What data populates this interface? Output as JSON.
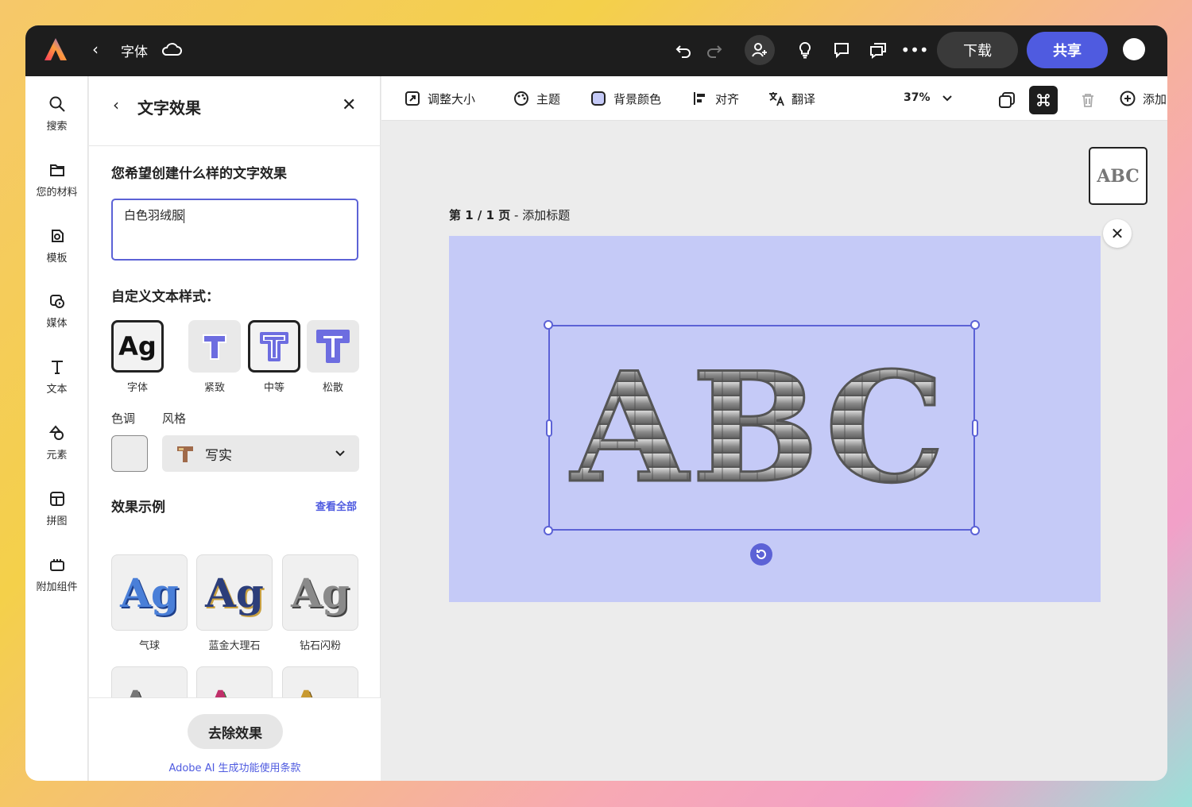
{
  "header": {
    "title": "字体",
    "download_label": "下载",
    "share_label": "共享"
  },
  "rail": {
    "items": [
      {
        "label": "搜索",
        "icon": "search-icon"
      },
      {
        "label": "您的材料",
        "icon": "folder-icon"
      },
      {
        "label": "模板",
        "icon": "templates-icon"
      },
      {
        "label": "媒体",
        "icon": "media-icon"
      },
      {
        "label": "文本",
        "icon": "text-icon"
      },
      {
        "label": "元素",
        "icon": "shapes-icon"
      },
      {
        "label": "拼图",
        "icon": "grid-icon"
      },
      {
        "label": "附加组件",
        "icon": "addons-icon"
      }
    ]
  },
  "panel": {
    "title": "文字效果",
    "question": "您希望创建什么样的文字效果",
    "prompt_value": "白色羽绒服",
    "custom_label": "自定义文本样式：",
    "styles": [
      {
        "label": "字体",
        "selected": true
      },
      {
        "label": "紧致",
        "selected": false
      },
      {
        "label": "中等",
        "selected": true
      },
      {
        "label": "松散",
        "selected": false
      }
    ],
    "tone_label": "色调",
    "style_label": "风格",
    "style_value": "写实",
    "examples_label": "效果示例",
    "see_all": "查看全部",
    "examples": [
      {
        "label": "气球",
        "text": "Ag",
        "color": "#4a7fd8"
      },
      {
        "label": "蓝金大理石",
        "text": "Ag",
        "color": "#2c3e7a"
      },
      {
        "label": "钻石闪粉",
        "text": "Ag",
        "color": "#8a8a8a"
      },
      {
        "label": "",
        "text": "Ag",
        "color": "#777777"
      },
      {
        "label": "",
        "text": "Ag",
        "color": "#c0306a"
      },
      {
        "label": "",
        "text": "Ag",
        "color": "#c89a30"
      }
    ],
    "remove_label": "去除效果",
    "terms": "Adobe AI 生成功能使用条款"
  },
  "toolbar": {
    "resize": "调整大小",
    "theme": "主题",
    "bg_color": "背景颜色",
    "align": "对齐",
    "translate": "翻译",
    "zoom": "37%",
    "add": "添加"
  },
  "canvas": {
    "page_label_bold": "第 1 / 1 页",
    "page_label_rest": " - 添加标题",
    "artboard_color": "#c5caf7",
    "text": "ABC",
    "thumbnail_text": "ABC"
  },
  "colors": {
    "accent": "#4f5be0",
    "topbar": "#1d1d1d"
  }
}
